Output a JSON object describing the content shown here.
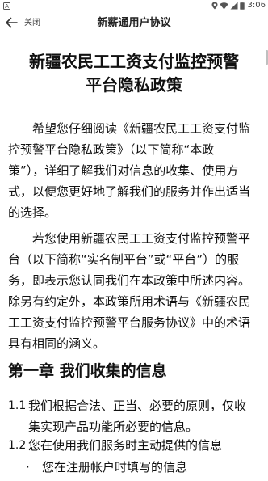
{
  "status_bar": {
    "time": "3:06",
    "icons": [
      "location-icon",
      "wifi-icon",
      "signal-icon",
      "battery-icon"
    ]
  },
  "app_bar": {
    "back_icon": "arrow-left-icon",
    "close_label": "关闭",
    "title": "新薪通用户协议"
  },
  "document": {
    "title_lines": [
      "新疆农民工工资支付监控预警",
      "平台隐私政策"
    ],
    "intro": [
      "希望您仔细阅读《新疆农民工工资支付监",
      "控预警平台隐私政策》（以下简称“本政",
      "策”），详细了解我们对信息的收集、使用方",
      "式，以便您更好地了解我们的服务并作出适当",
      "的选择。"
    ],
    "scope": [
      "若您使用新疆农民工工资支付监控预警平",
      "台（以下简称“实名制平台”或“平台”）的服",
      "务，即表示您认同我们在本政策中所述内容。",
      "除另有约定外，本政策所用术语与《新疆农民",
      "工工资支付监控预警平台服务协议》中的术语",
      "具有相同的涵义。"
    ],
    "chapter_title": "第一章 我们收集的信息",
    "clauses": [
      {
        "num": "1.1",
        "lines": [
          "我们根据合法、正当、必要的原则，仅收",
          "集实现产品功能所必要的信息。"
        ]
      },
      {
        "num": "1.2",
        "lines": [
          "您在使用我们服务时主动提供的信息"
        ]
      }
    ],
    "bullets": [
      "您在注册帐户时填写的信息"
    ]
  }
}
